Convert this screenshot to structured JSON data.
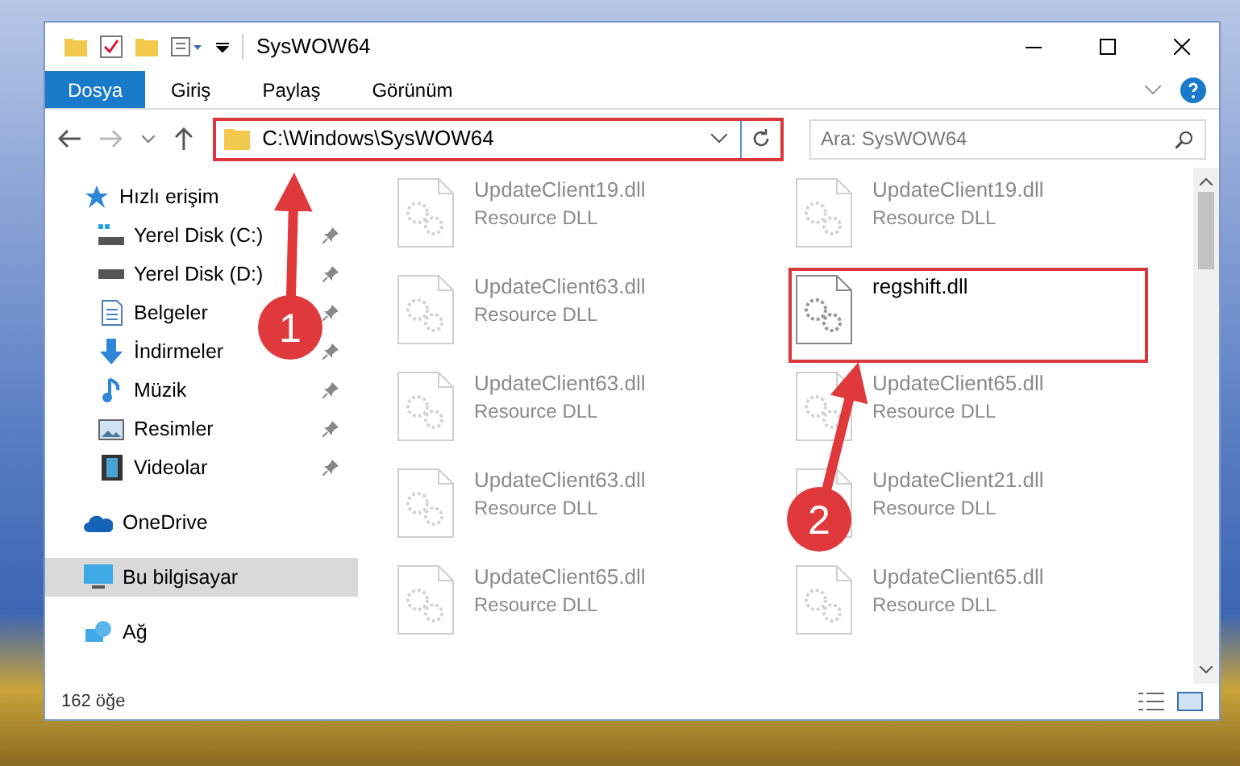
{
  "window": {
    "title": "SysWOW64"
  },
  "ribbon_tabs": [
    {
      "label": "Dosya",
      "selected": true
    },
    {
      "label": "Giriş",
      "selected": false
    },
    {
      "label": "Paylaş",
      "selected": false
    },
    {
      "label": "Görünüm",
      "selected": false
    }
  ],
  "address": {
    "path": "C:\\Windows\\SysWOW64",
    "highlighted": true
  },
  "search": {
    "placeholder": "Ara: SysWOW64"
  },
  "sidebar": {
    "items": [
      {
        "label": "Hızlı erişim",
        "selected": false,
        "children": [
          {
            "label": "Yerel Disk (C:)",
            "pinned": true
          },
          {
            "label": "Yerel Disk (D:)",
            "pinned": true
          },
          {
            "label": "Belgeler",
            "pinned": true
          },
          {
            "label": "İndirmeler",
            "pinned": true
          },
          {
            "label": "Müzik",
            "pinned": true
          },
          {
            "label": "Resimler",
            "pinned": true
          },
          {
            "label": "Videolar",
            "pinned": true
          }
        ]
      },
      {
        "label": "OneDrive",
        "selected": false
      },
      {
        "label": "Bu bilgisayar",
        "selected": true
      },
      {
        "label": "Ağ",
        "selected": false
      }
    ]
  },
  "files": [
    {
      "name": "UpdateClient19.dll",
      "type": "Resource DLL",
      "blurred": true,
      "highlighted": false
    },
    {
      "name": "UpdateClient19.dll",
      "type": "Resource DLL",
      "blurred": true,
      "highlighted": false
    },
    {
      "name": "UpdateClient63.dll",
      "type": "Resource DLL",
      "blurred": true,
      "highlighted": false
    },
    {
      "name": "regshift.dll",
      "blurred": false,
      "highlighted": true
    },
    {
      "name": "UpdateClient63.dll",
      "type": "Resource DLL",
      "blurred": true,
      "highlighted": false
    },
    {
      "name": "UpdateClient65.dll",
      "type": "Resource DLL",
      "blurred": true,
      "highlighted": false
    },
    {
      "name": "UpdateClient63.dll",
      "type": "Resource DLL",
      "blurred": true,
      "highlighted": false
    },
    {
      "name": "UpdateClient21.dll",
      "type": "Resource DLL",
      "blurred": true,
      "highlighted": false
    },
    {
      "name": "UpdateClient65.dll",
      "type": "Resource DLL",
      "blurred": true,
      "highlighted": false
    },
    {
      "name": "UpdateClient65.dll",
      "type": "Resource DLL",
      "blurred": true,
      "highlighted": false
    }
  ],
  "annotations": [
    {
      "label": "1"
    },
    {
      "label": "2"
    }
  ],
  "status_bar": {
    "count": "162 öğe"
  }
}
